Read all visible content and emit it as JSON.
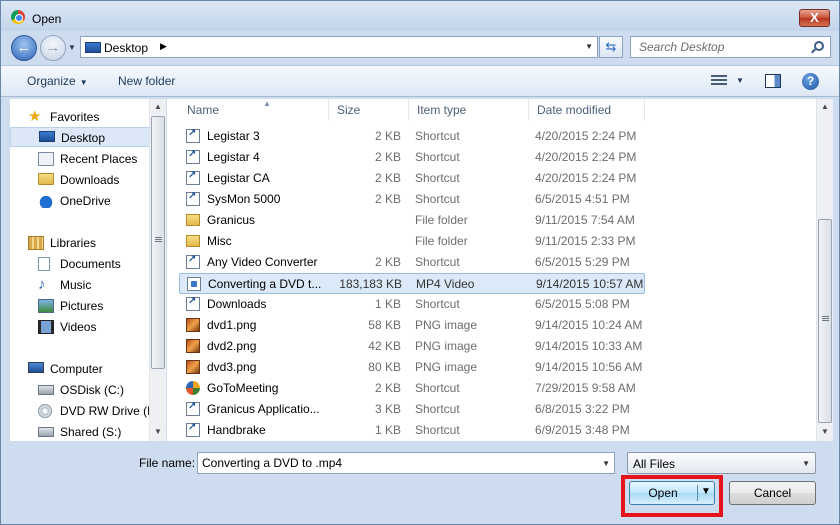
{
  "window": {
    "title": "Open",
    "close_label": "X"
  },
  "address_bar": {
    "location": "Desktop",
    "separator": "▶",
    "refresh_glyph": "⇆"
  },
  "search": {
    "placeholder": "Search Desktop"
  },
  "toolbar": {
    "organize_label": "Organize",
    "new_folder_label": "New folder",
    "help_glyph": "?"
  },
  "nav_pane": {
    "items": [
      {
        "label": "Favorites",
        "icon": "star-icon"
      },
      {
        "label": "Desktop",
        "icon": "desktop-icon",
        "selected": true
      },
      {
        "label": "Recent Places",
        "icon": "recent-places-icon"
      },
      {
        "label": "Downloads",
        "icon": "downloads-folder-icon"
      },
      {
        "label": "OneDrive",
        "icon": "onedrive-icon"
      },
      {
        "label": "Libraries",
        "icon": "libraries-icon"
      },
      {
        "label": "Documents",
        "icon": "documents-icon"
      },
      {
        "label": "Music",
        "icon": "music-icon"
      },
      {
        "label": "Pictures",
        "icon": "pictures-icon"
      },
      {
        "label": "Videos",
        "icon": "videos-icon"
      },
      {
        "label": "Computer",
        "icon": "computer-icon"
      },
      {
        "label": "OSDisk (C:)",
        "icon": "disk-icon"
      },
      {
        "label": "DVD RW Drive (D",
        "icon": "dvd-drive-icon"
      },
      {
        "label": "Shared (S:)",
        "icon": "network-drive-icon"
      }
    ]
  },
  "file_list": {
    "columns": [
      "Name",
      "Size",
      "Item type",
      "Date modified"
    ],
    "rows": [
      {
        "name": "Legistar 3",
        "size": "2 KB",
        "type": "Shortcut",
        "date": "4/20/2015 2:24 PM",
        "icon": "shortcut-icon"
      },
      {
        "name": "Legistar 4",
        "size": "2 KB",
        "type": "Shortcut",
        "date": "4/20/2015 2:24 PM",
        "icon": "shortcut-icon"
      },
      {
        "name": "Legistar CA",
        "size": "2 KB",
        "type": "Shortcut",
        "date": "4/20/2015 2:24 PM",
        "icon": "shortcut-icon"
      },
      {
        "name": "SysMon 5000",
        "size": "2 KB",
        "type": "Shortcut",
        "date": "6/5/2015 4:51 PM",
        "icon": "shortcut-icon"
      },
      {
        "name": "Granicus",
        "size": "",
        "type": "File folder",
        "date": "9/11/2015 7:54 AM",
        "icon": "folder-icon"
      },
      {
        "name": "Misc",
        "size": "",
        "type": "File folder",
        "date": "9/11/2015 2:33 PM",
        "icon": "folder-icon"
      },
      {
        "name": "Any Video Converter",
        "size": "2 KB",
        "type": "Shortcut",
        "date": "6/5/2015 5:29 PM",
        "icon": "shortcut-icon"
      },
      {
        "name": "Converting a DVD t...",
        "size": "183,183 KB",
        "type": "MP4 Video",
        "date": "9/14/2015 10:57 AM",
        "icon": "video-file-icon",
        "selected": true
      },
      {
        "name": "Downloads",
        "size": "1 KB",
        "type": "Shortcut",
        "date": "6/5/2015 5:08 PM",
        "icon": "shortcut-icon"
      },
      {
        "name": "dvd1.png",
        "size": "58 KB",
        "type": "PNG image",
        "date": "9/14/2015 10:24 AM",
        "icon": "png-file-icon"
      },
      {
        "name": "dvd2.png",
        "size": "42 KB",
        "type": "PNG image",
        "date": "9/14/2015 10:33 AM",
        "icon": "png-file-icon"
      },
      {
        "name": "dvd3.png",
        "size": "80 KB",
        "type": "PNG image",
        "date": "9/14/2015 10:56 AM",
        "icon": "png-file-icon"
      },
      {
        "name": "GoToMeeting",
        "size": "2 KB",
        "type": "Shortcut",
        "date": "7/29/2015 9:58 AM",
        "icon": "gotomeeting-icon"
      },
      {
        "name": "Granicus Applicatio...",
        "size": "3 KB",
        "type": "Shortcut",
        "date": "6/8/2015 3:22 PM",
        "icon": "shortcut-icon"
      },
      {
        "name": "Handbrake",
        "size": "1 KB",
        "type": "Shortcut",
        "date": "6/9/2015 3:48 PM",
        "icon": "shortcut-icon"
      }
    ]
  },
  "bottom": {
    "file_name_label": "File name:",
    "file_name_value": "Converting a DVD to .mp4",
    "filter_value": "All Files",
    "open_label": "Open",
    "cancel_label": "Cancel"
  },
  "colors": {
    "highlight_box": "#e8141c",
    "selection": "#dbe9f8",
    "chrome": "#cddcee"
  }
}
